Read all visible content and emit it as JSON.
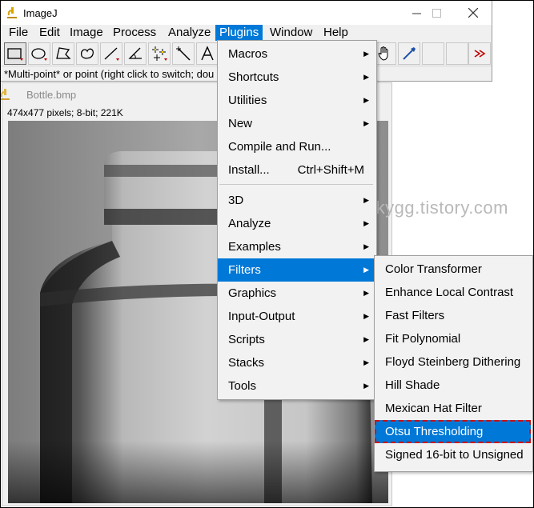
{
  "window": {
    "title": "ImageJ"
  },
  "menubar": [
    "File",
    "Edit",
    "Image",
    "Process",
    "Analyze",
    "Plugins",
    "Window",
    "Help"
  ],
  "status_text": "*Multi-point* or point (right click to switch; dou",
  "image_window": {
    "title": "Bottle.bmp",
    "info": "474x477 pixels; 8-bit; 221K"
  },
  "watermark": "luckygg.tistory.com",
  "plugins_menu": [
    {
      "label": "Macros",
      "submenu": true
    },
    {
      "label": "Shortcuts",
      "submenu": true
    },
    {
      "label": "Utilities",
      "submenu": true
    },
    {
      "label": "New",
      "submenu": true
    },
    {
      "label": "Compile and Run...",
      "submenu": false
    },
    {
      "label": "Install...",
      "shortcut": "Ctrl+Shift+M",
      "submenu": false
    },
    {
      "label": "3D",
      "submenu": true
    },
    {
      "label": "Analyze",
      "submenu": true
    },
    {
      "label": "Examples",
      "submenu": true
    },
    {
      "label": "Filters",
      "submenu": true,
      "highlighted": true
    },
    {
      "label": "Graphics",
      "submenu": true
    },
    {
      "label": "Input-Output",
      "submenu": true
    },
    {
      "label": "Scripts",
      "submenu": true
    },
    {
      "label": "Stacks",
      "submenu": true
    },
    {
      "label": "Tools",
      "submenu": true
    }
  ],
  "filters_menu": [
    {
      "label": "Color Transformer"
    },
    {
      "label": "Enhance Local Contrast"
    },
    {
      "label": "Fast Filters"
    },
    {
      "label": "Fit Polynomial"
    },
    {
      "label": "Floyd Steinberg Dithering"
    },
    {
      "label": "Hill Shade"
    },
    {
      "label": "Mexican Hat Filter"
    },
    {
      "label": "Otsu Thresholding",
      "highlighted": true,
      "annotated": true
    },
    {
      "label": "Signed 16-bit to Unsigned"
    }
  ],
  "colors": {
    "accent": "#0078d7",
    "annotation": "#d01010",
    "menu_bg": "#f2f2f2"
  },
  "toolbar_icons": [
    "rectangle-select-icon",
    "oval-select-icon",
    "polygon-select-icon",
    "freehand-select-icon",
    "line-tool-icon",
    "angle-tool-icon",
    "multipoint-icon",
    "wand-tool-icon",
    "text-tool-icon",
    "hand-tool-icon",
    "dropper-tool-icon",
    "more-tools-icon"
  ]
}
